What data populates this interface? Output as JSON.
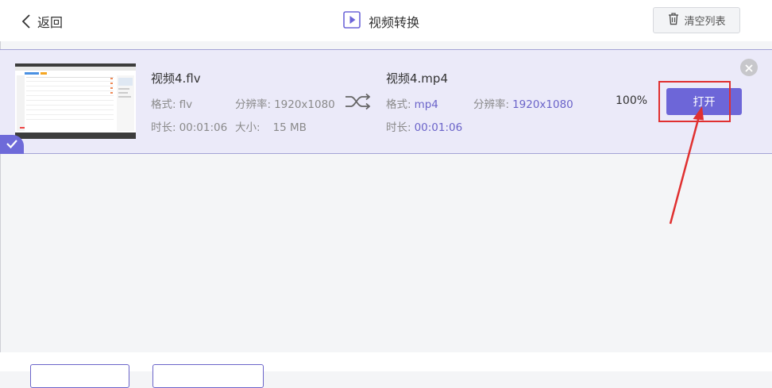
{
  "header": {
    "back_label": "返回",
    "title": "视频转换",
    "clear_label": "清空列表"
  },
  "item": {
    "source": {
      "filename": "视频4.flv",
      "format_label": "格式:",
      "format_value": "flv",
      "resolution_label": "分辨率:",
      "resolution_value": "1920x1080",
      "duration_label": "时长:",
      "duration_value": "00:01:06",
      "size_label": "大小:",
      "size_value": "15 MB"
    },
    "target": {
      "filename": "视频4.mp4",
      "format_label": "格式:",
      "format_value": "mp4",
      "resolution_label": "分辨率:",
      "resolution_value": "1920x1080",
      "duration_label": "时长:",
      "duration_value": "00:01:06"
    },
    "progress": "100%",
    "open_label": "打开",
    "selected": true
  },
  "colors": {
    "accent": "#6d66d8",
    "row_bg": "#ebeaf9",
    "annotation": "#e03030"
  },
  "icons": {
    "back": "chevron-left-icon",
    "title": "play-icon",
    "clear": "trash-icon",
    "convert": "shuffle-icon",
    "remove": "close-icon",
    "selected": "checkmark-icon"
  }
}
